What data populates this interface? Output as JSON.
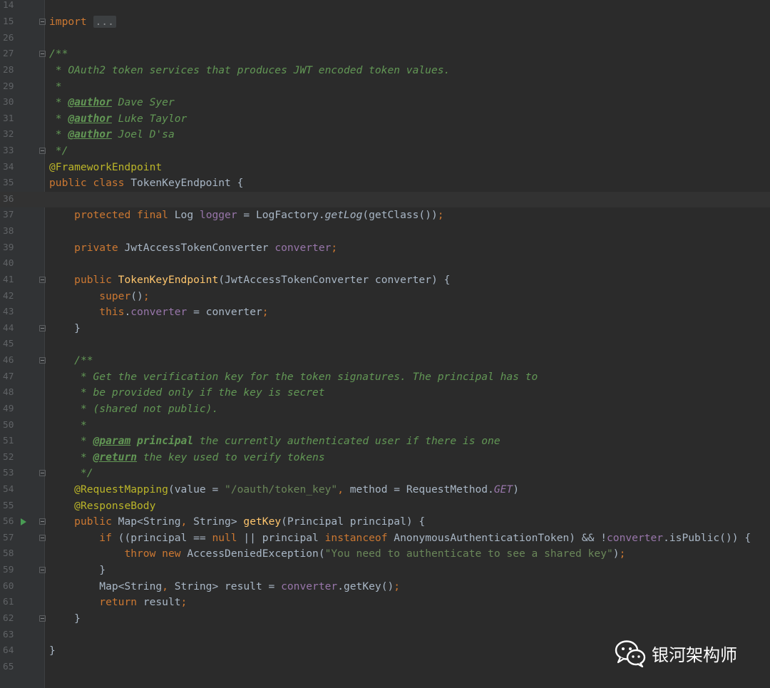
{
  "editor": {
    "lines": [
      {
        "n": "14",
        "t": [],
        "fold": false
      },
      {
        "n": "15",
        "t": [
          [
            "kw",
            "import"
          ],
          [
            "p",
            " "
          ],
          [
            "fold-box",
            "..."
          ]
        ],
        "fold": true
      },
      {
        "n": "26",
        "t": [],
        "fold": false
      },
      {
        "n": "27",
        "t": [
          [
            "doc",
            "/**"
          ]
        ],
        "fold": true
      },
      {
        "n": "28",
        "t": [
          [
            "doc",
            " * OAuth2 token services that produces JWT encoded token values."
          ]
        ],
        "fold": false
      },
      {
        "n": "29",
        "t": [
          [
            "doc",
            " *"
          ]
        ],
        "fold": false
      },
      {
        "n": "30",
        "t": [
          [
            "doc",
            " * "
          ],
          [
            "tag",
            "@author"
          ],
          [
            "doc",
            " Dave Syer"
          ]
        ],
        "fold": false
      },
      {
        "n": "31",
        "t": [
          [
            "doc",
            " * "
          ],
          [
            "tag",
            "@author"
          ],
          [
            "doc",
            " Luke Taylor"
          ]
        ],
        "fold": false
      },
      {
        "n": "32",
        "t": [
          [
            "doc",
            " * "
          ],
          [
            "tag",
            "@author"
          ],
          [
            "doc",
            " Joel D'sa"
          ]
        ],
        "fold": false
      },
      {
        "n": "33",
        "t": [
          [
            "doc",
            " */"
          ]
        ],
        "fold": true
      },
      {
        "n": "34",
        "t": [
          [
            "ann",
            "@FrameworkEndpoint"
          ]
        ],
        "fold": false
      },
      {
        "n": "35",
        "t": [
          [
            "kw",
            "public class "
          ],
          [
            "p",
            "TokenKeyEndpoint {"
          ]
        ],
        "fold": false
      },
      {
        "n": "36",
        "t": [],
        "fold": false,
        "current": true
      },
      {
        "n": "37",
        "t": [
          [
            "p",
            "    "
          ],
          [
            "kw",
            "protected final "
          ],
          [
            "p",
            "Log "
          ],
          [
            "fld",
            "logger"
          ],
          [
            "p",
            " = LogFactory."
          ],
          [
            "it",
            "getLog"
          ],
          [
            "p",
            "(getClass())"
          ],
          [
            "kw",
            ";"
          ]
        ],
        "fold": false
      },
      {
        "n": "38",
        "t": [],
        "fold": false
      },
      {
        "n": "39",
        "t": [
          [
            "p",
            "    "
          ],
          [
            "kw",
            "private "
          ],
          [
            "p",
            "JwtAccessTokenConverter "
          ],
          [
            "fld",
            "converter"
          ],
          [
            "kw",
            ";"
          ]
        ],
        "fold": false
      },
      {
        "n": "40",
        "t": [],
        "fold": false
      },
      {
        "n": "41",
        "t": [
          [
            "p",
            "    "
          ],
          [
            "kw",
            "public "
          ],
          [
            "fn",
            "TokenKeyEndpoint"
          ],
          [
            "p",
            "(JwtAccessTokenConverter converter) {"
          ]
        ],
        "fold": true
      },
      {
        "n": "42",
        "t": [
          [
            "p",
            "        "
          ],
          [
            "kw",
            "super"
          ],
          [
            "p",
            "()"
          ],
          [
            "kw",
            ";"
          ]
        ],
        "fold": false
      },
      {
        "n": "43",
        "t": [
          [
            "p",
            "        "
          ],
          [
            "kw",
            "this"
          ],
          [
            "p",
            "."
          ],
          [
            "fld",
            "converter"
          ],
          [
            "p",
            " = converter"
          ],
          [
            "kw",
            ";"
          ]
        ],
        "fold": false
      },
      {
        "n": "44",
        "t": [
          [
            "p",
            "    }"
          ]
        ],
        "fold": true
      },
      {
        "n": "45",
        "t": [],
        "fold": false
      },
      {
        "n": "46",
        "t": [
          [
            "p",
            "    "
          ],
          [
            "doc",
            "/**"
          ]
        ],
        "fold": true
      },
      {
        "n": "47",
        "t": [
          [
            "doc",
            "     * Get the verification key for the token signatures. The principal has to"
          ]
        ],
        "fold": false
      },
      {
        "n": "48",
        "t": [
          [
            "doc",
            "     * be provided only if the key is secret"
          ]
        ],
        "fold": false
      },
      {
        "n": "49",
        "t": [
          [
            "doc",
            "     * (shared not public)."
          ]
        ],
        "fold": false
      },
      {
        "n": "50",
        "t": [
          [
            "doc",
            "     *"
          ]
        ],
        "fold": false
      },
      {
        "n": "51",
        "t": [
          [
            "doc",
            "     * "
          ],
          [
            "tag",
            "@param"
          ],
          [
            "doc",
            " "
          ],
          [
            "docb",
            "principal"
          ],
          [
            "doc",
            " the currently authenticated user if there is one"
          ]
        ],
        "fold": false
      },
      {
        "n": "52",
        "t": [
          [
            "doc",
            "     * "
          ],
          [
            "tag",
            "@return"
          ],
          [
            "doc",
            " the key used to verify tokens"
          ]
        ],
        "fold": false
      },
      {
        "n": "53",
        "t": [
          [
            "doc",
            "     */"
          ]
        ],
        "fold": true
      },
      {
        "n": "54",
        "t": [
          [
            "p",
            "    "
          ],
          [
            "ann",
            "@RequestMapping"
          ],
          [
            "p",
            "(value = "
          ],
          [
            "str",
            "\"/oauth/token_key\""
          ],
          [
            "kw",
            ", "
          ],
          [
            "p",
            "method = RequestMethod."
          ],
          [
            "sta",
            "GET"
          ],
          [
            "p",
            ")"
          ]
        ],
        "fold": false
      },
      {
        "n": "55",
        "t": [
          [
            "p",
            "    "
          ],
          [
            "ann",
            "@ResponseBody"
          ]
        ],
        "fold": false
      },
      {
        "n": "56",
        "t": [
          [
            "p",
            "    "
          ],
          [
            "kw",
            "public "
          ],
          [
            "p",
            "Map<String"
          ],
          [
            "kw",
            ", "
          ],
          [
            "p",
            "String> "
          ],
          [
            "fn",
            "getKey"
          ],
          [
            "p",
            "(Principal principal) {"
          ]
        ],
        "fold": true,
        "run": true
      },
      {
        "n": "57",
        "t": [
          [
            "p",
            "        "
          ],
          [
            "kw",
            "if "
          ],
          [
            "p",
            "((principal == "
          ],
          [
            "kw",
            "null "
          ],
          [
            "p",
            "|| principal "
          ],
          [
            "kw",
            "instanceof "
          ],
          [
            "p",
            "AnonymousAuthenticationToken) && !"
          ],
          [
            "fld",
            "converter"
          ],
          [
            "p",
            ".isPublic()) {"
          ]
        ],
        "fold": true
      },
      {
        "n": "58",
        "t": [
          [
            "p",
            "            "
          ],
          [
            "kw",
            "throw new "
          ],
          [
            "p",
            "AccessDeniedException("
          ],
          [
            "str",
            "\"You need to authenticate to see a shared key\""
          ],
          [
            "p",
            ")"
          ],
          [
            "kw",
            ";"
          ]
        ],
        "fold": false
      },
      {
        "n": "59",
        "t": [
          [
            "p",
            "        }"
          ]
        ],
        "fold": true
      },
      {
        "n": "60",
        "t": [
          [
            "p",
            "        Map<String"
          ],
          [
            "kw",
            ", "
          ],
          [
            "p",
            "String> result = "
          ],
          [
            "fld",
            "converter"
          ],
          [
            "p",
            ".getKey()"
          ],
          [
            "kw",
            ";"
          ]
        ],
        "fold": false
      },
      {
        "n": "61",
        "t": [
          [
            "p",
            "        "
          ],
          [
            "kw",
            "return "
          ],
          [
            "p",
            "result"
          ],
          [
            "kw",
            ";"
          ]
        ],
        "fold": false
      },
      {
        "n": "62",
        "t": [
          [
            "p",
            "    }"
          ]
        ],
        "fold": true
      },
      {
        "n": "63",
        "t": [],
        "fold": false
      },
      {
        "n": "64",
        "t": [
          [
            "p",
            "}"
          ]
        ],
        "fold": false
      },
      {
        "n": "65",
        "t": [],
        "fold": false
      }
    ]
  },
  "watermark": {
    "text": "银河架构师",
    "icon": "wechat-icon"
  },
  "colors": {
    "background": "#2b2b2b",
    "gutter": "#313335",
    "keyword": "#cc7832",
    "annotation": "#bbb529",
    "string": "#6a8759",
    "doc_comment": "#629755",
    "field": "#9876aa",
    "method_decl": "#ffc66d",
    "plain": "#a9b7c6",
    "line_number": "#606366"
  }
}
